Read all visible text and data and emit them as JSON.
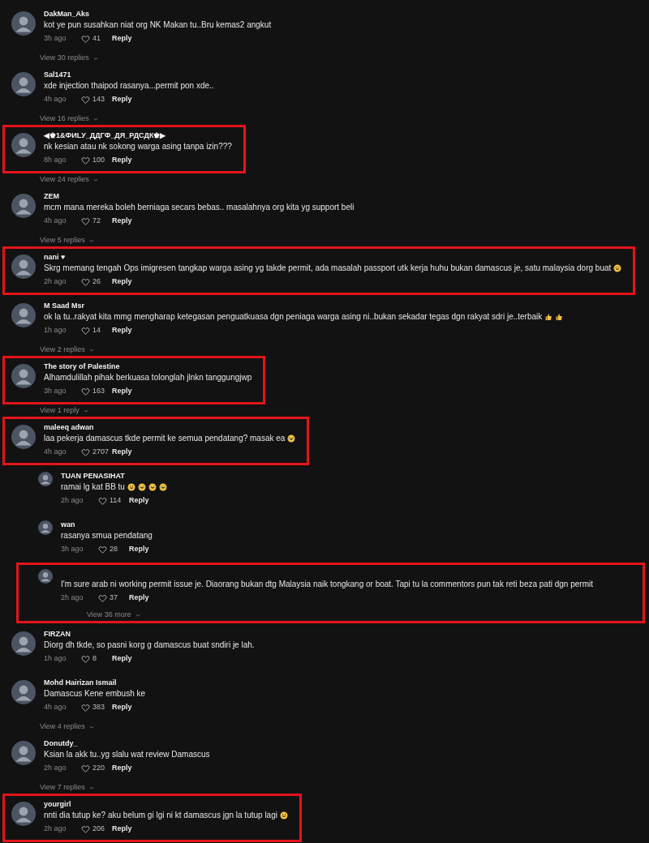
{
  "comments": [
    {
      "kind": "comment",
      "name": "DakMan_Aks",
      "text": "kot ye pun susahkan niat org NK Makan tu..Bru kemas2 angkut",
      "time": "3h ago",
      "likes": "41",
      "reply": "Reply",
      "highlighted": false,
      "view_replies": "View 30 replies"
    },
    {
      "kind": "comment",
      "name": "Sal1471",
      "text": "xde injection thaipod rasanya...permit pon xde..",
      "time": "4h ago",
      "likes": "143",
      "reply": "Reply",
      "highlighted": false,
      "view_replies": "View 16 replies"
    },
    {
      "kind": "comment",
      "name": "◀♚1&ФИLУ_ДДГФ_ДЯ_РДСДК♚▶",
      "text": "nk kesian atau nk sokong warga asing tanpa izin???",
      "time": "8h ago",
      "likes": "100",
      "reply": "Reply",
      "highlighted": true,
      "view_replies": "View 24 replies"
    },
    {
      "kind": "comment",
      "name": "ZEM",
      "text": "mcm mana mereka boleh berniaga secars bebas.. masalahnya org kita yg support beli",
      "time": "4h ago",
      "likes": "72",
      "reply": "Reply",
      "highlighted": false,
      "view_replies": "View 5 replies"
    },
    {
      "kind": "comment",
      "name": "nani ♥",
      "text": "Skrg memang tengah Ops imigresen tangkap warga asing yg takde permit, ada masalah passport utk kerja huhu bukan damascus je, satu malaysia dorg buat",
      "emojis": [
        {
          "kind": "smile"
        }
      ],
      "time": "2h ago",
      "likes": "26",
      "reply": "Reply",
      "highlighted": true
    },
    {
      "kind": "comment",
      "name": "M Saad Msr",
      "text": "ok la tu..rakyat kita mmg mengharap ketegasan penguatkuasa dgn peniaga warga asing ni..bukan sekadar tegas dgn rakyat sdri je..terbaik",
      "emojis": [
        {
          "kind": "thumbs"
        },
        {
          "kind": "thumbs"
        }
      ],
      "time": "1h ago",
      "likes": "14",
      "reply": "Reply",
      "highlighted": false,
      "view_replies": "View 2 replies"
    },
    {
      "kind": "comment",
      "name": "The story of Palestine",
      "text": "Alhamdulillah pihak berkuasa tolonglah jlnkn tanggungjwp",
      "time": "3h ago",
      "likes": "163",
      "reply": "Reply",
      "highlighted": true,
      "view_replies": "View 1 reply"
    },
    {
      "kind": "comment",
      "name": "maleeq adwan",
      "text": "laa pekerja damascus tkde permit ke semua pendatang? masak ea",
      "emojis": [
        {
          "kind": "laugh"
        }
      ],
      "time": "4h ago",
      "likes": "2707",
      "reply": "Reply",
      "highlighted": true
    },
    {
      "kind": "reply",
      "name": "TUAN PENASIHAT",
      "text": "ramai lg kat BB tu",
      "emojis": [
        {
          "kind": "smile"
        },
        {
          "kind": "laugh"
        },
        {
          "kind": "laugh"
        },
        {
          "kind": "laugh"
        }
      ],
      "time": "2h ago",
      "likes": "114",
      "reply": "Reply",
      "highlighted": false
    },
    {
      "kind": "reply",
      "name": "wan",
      "text": "rasanya smua pendatang",
      "time": "3h ago",
      "likes": "28",
      "reply": "Reply",
      "highlighted": false
    },
    {
      "kind": "reply",
      "text": "I'm sure arab ni working permit issue je. Diaorang bukan dtg Malaysia naik tongkang or boat. Tapi tu la commentors pun tak reti beza pati dgn permit",
      "time": "2h ago",
      "likes": "37",
      "reply": "Reply",
      "highlighted": true,
      "view_replies": "View 36 more"
    },
    {
      "kind": "comment",
      "name": "FIRZAN",
      "text": "Diorg dh tkde, so pasni korg g damascus buat sndiri je lah.",
      "time": "1h ago",
      "likes": "8",
      "reply": "Reply",
      "highlighted": false
    },
    {
      "kind": "comment",
      "name": "Mohd Hairizan Ismail",
      "text": "Damascus Kene embush ke",
      "time": "4h ago",
      "likes": "383",
      "reply": "Reply",
      "highlighted": false,
      "view_replies": "View 4 replies"
    },
    {
      "kind": "comment",
      "name": "Donutdy_",
      "text": "Ksian la akk tu..yg slalu wat review Damascus",
      "time": "2h ago",
      "likes": "220",
      "reply": "Reply",
      "highlighted": false,
      "view_replies": "View 7 replies"
    },
    {
      "kind": "comment",
      "name": "yourgirl",
      "text": "nnti dia tutup ke? aku belum gi lgi ni kt damascus jgn la tutup lagi",
      "emojis": [
        {
          "kind": "smile"
        }
      ],
      "time": "2h ago",
      "likes": "206",
      "reply": "Reply",
      "highlighted": true
    }
  ]
}
